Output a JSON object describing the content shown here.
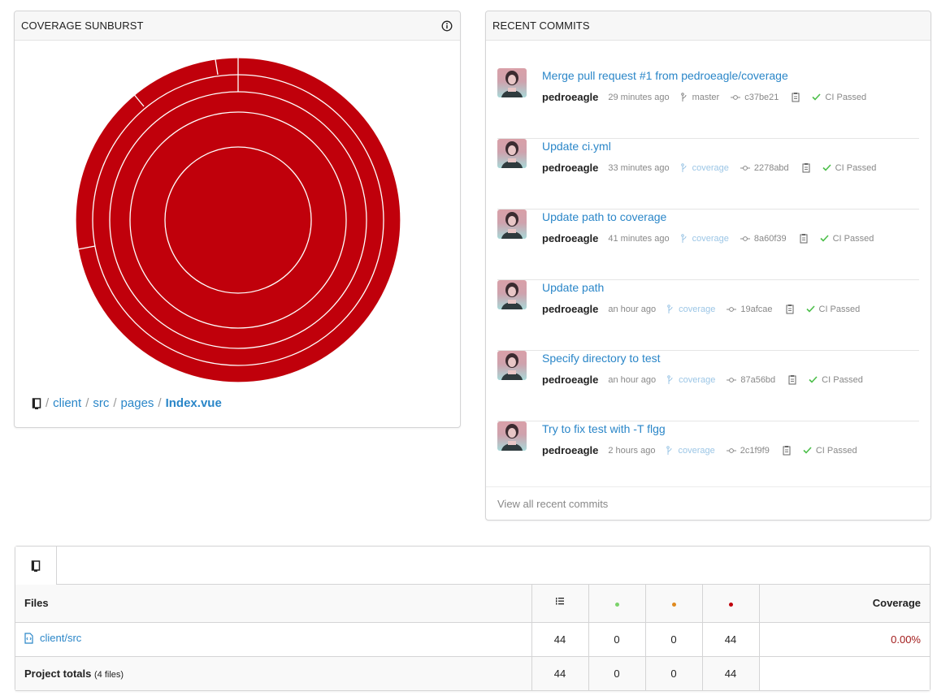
{
  "sunburst": {
    "title": "COVERAGE SUNBURST",
    "fill_color": "#c0000b",
    "breadcrumb": [
      "client",
      "src",
      "pages"
    ],
    "breadcrumb_current": "Index.vue"
  },
  "commits": {
    "title": "RECENT COMMITS",
    "items": [
      {
        "message": "Merge pull request #1 from pedroeagle/coverage",
        "author": "pedroeagle",
        "time": "29 minutes ago",
        "branch": "master",
        "sha": "c37be21",
        "ci": "CI Passed"
      },
      {
        "message": "Update ci.yml",
        "author": "pedroeagle",
        "time": "33 minutes ago",
        "branch": "coverage",
        "sha": "2278abd",
        "ci": "CI Passed"
      },
      {
        "message": "Update path to coverage",
        "author": "pedroeagle",
        "time": "41 minutes ago",
        "branch": "coverage",
        "sha": "8a60f39",
        "ci": "CI Passed"
      },
      {
        "message": "Update path",
        "author": "pedroeagle",
        "time": "an hour ago",
        "branch": "coverage",
        "sha": "19afcae",
        "ci": "CI Passed"
      },
      {
        "message": "Specify directory to test",
        "author": "pedroeagle",
        "time": "an hour ago",
        "branch": "coverage",
        "sha": "87a56bd",
        "ci": "CI Passed"
      },
      {
        "message": "Try to fix test with -T flgg",
        "author": "pedroeagle",
        "time": "2 hours ago",
        "branch": "coverage",
        "sha": "2c1f9f9",
        "ci": "CI Passed"
      }
    ],
    "view_all": "View all recent commits"
  },
  "files": {
    "headers": {
      "files": "Files",
      "coverage": "Coverage"
    },
    "dot_colors": {
      "hit": "#7bd36b",
      "partial": "#e08a1e",
      "miss": "#c0000b"
    },
    "rows": [
      {
        "name": "client/src",
        "lines": "44",
        "hit": "0",
        "partial": "0",
        "miss": "44",
        "coverage": "0.00%"
      }
    ],
    "totals": {
      "label": "Project totals",
      "sub": "(4 files)",
      "lines": "44",
      "hit": "0",
      "partial": "0",
      "miss": "44"
    }
  }
}
